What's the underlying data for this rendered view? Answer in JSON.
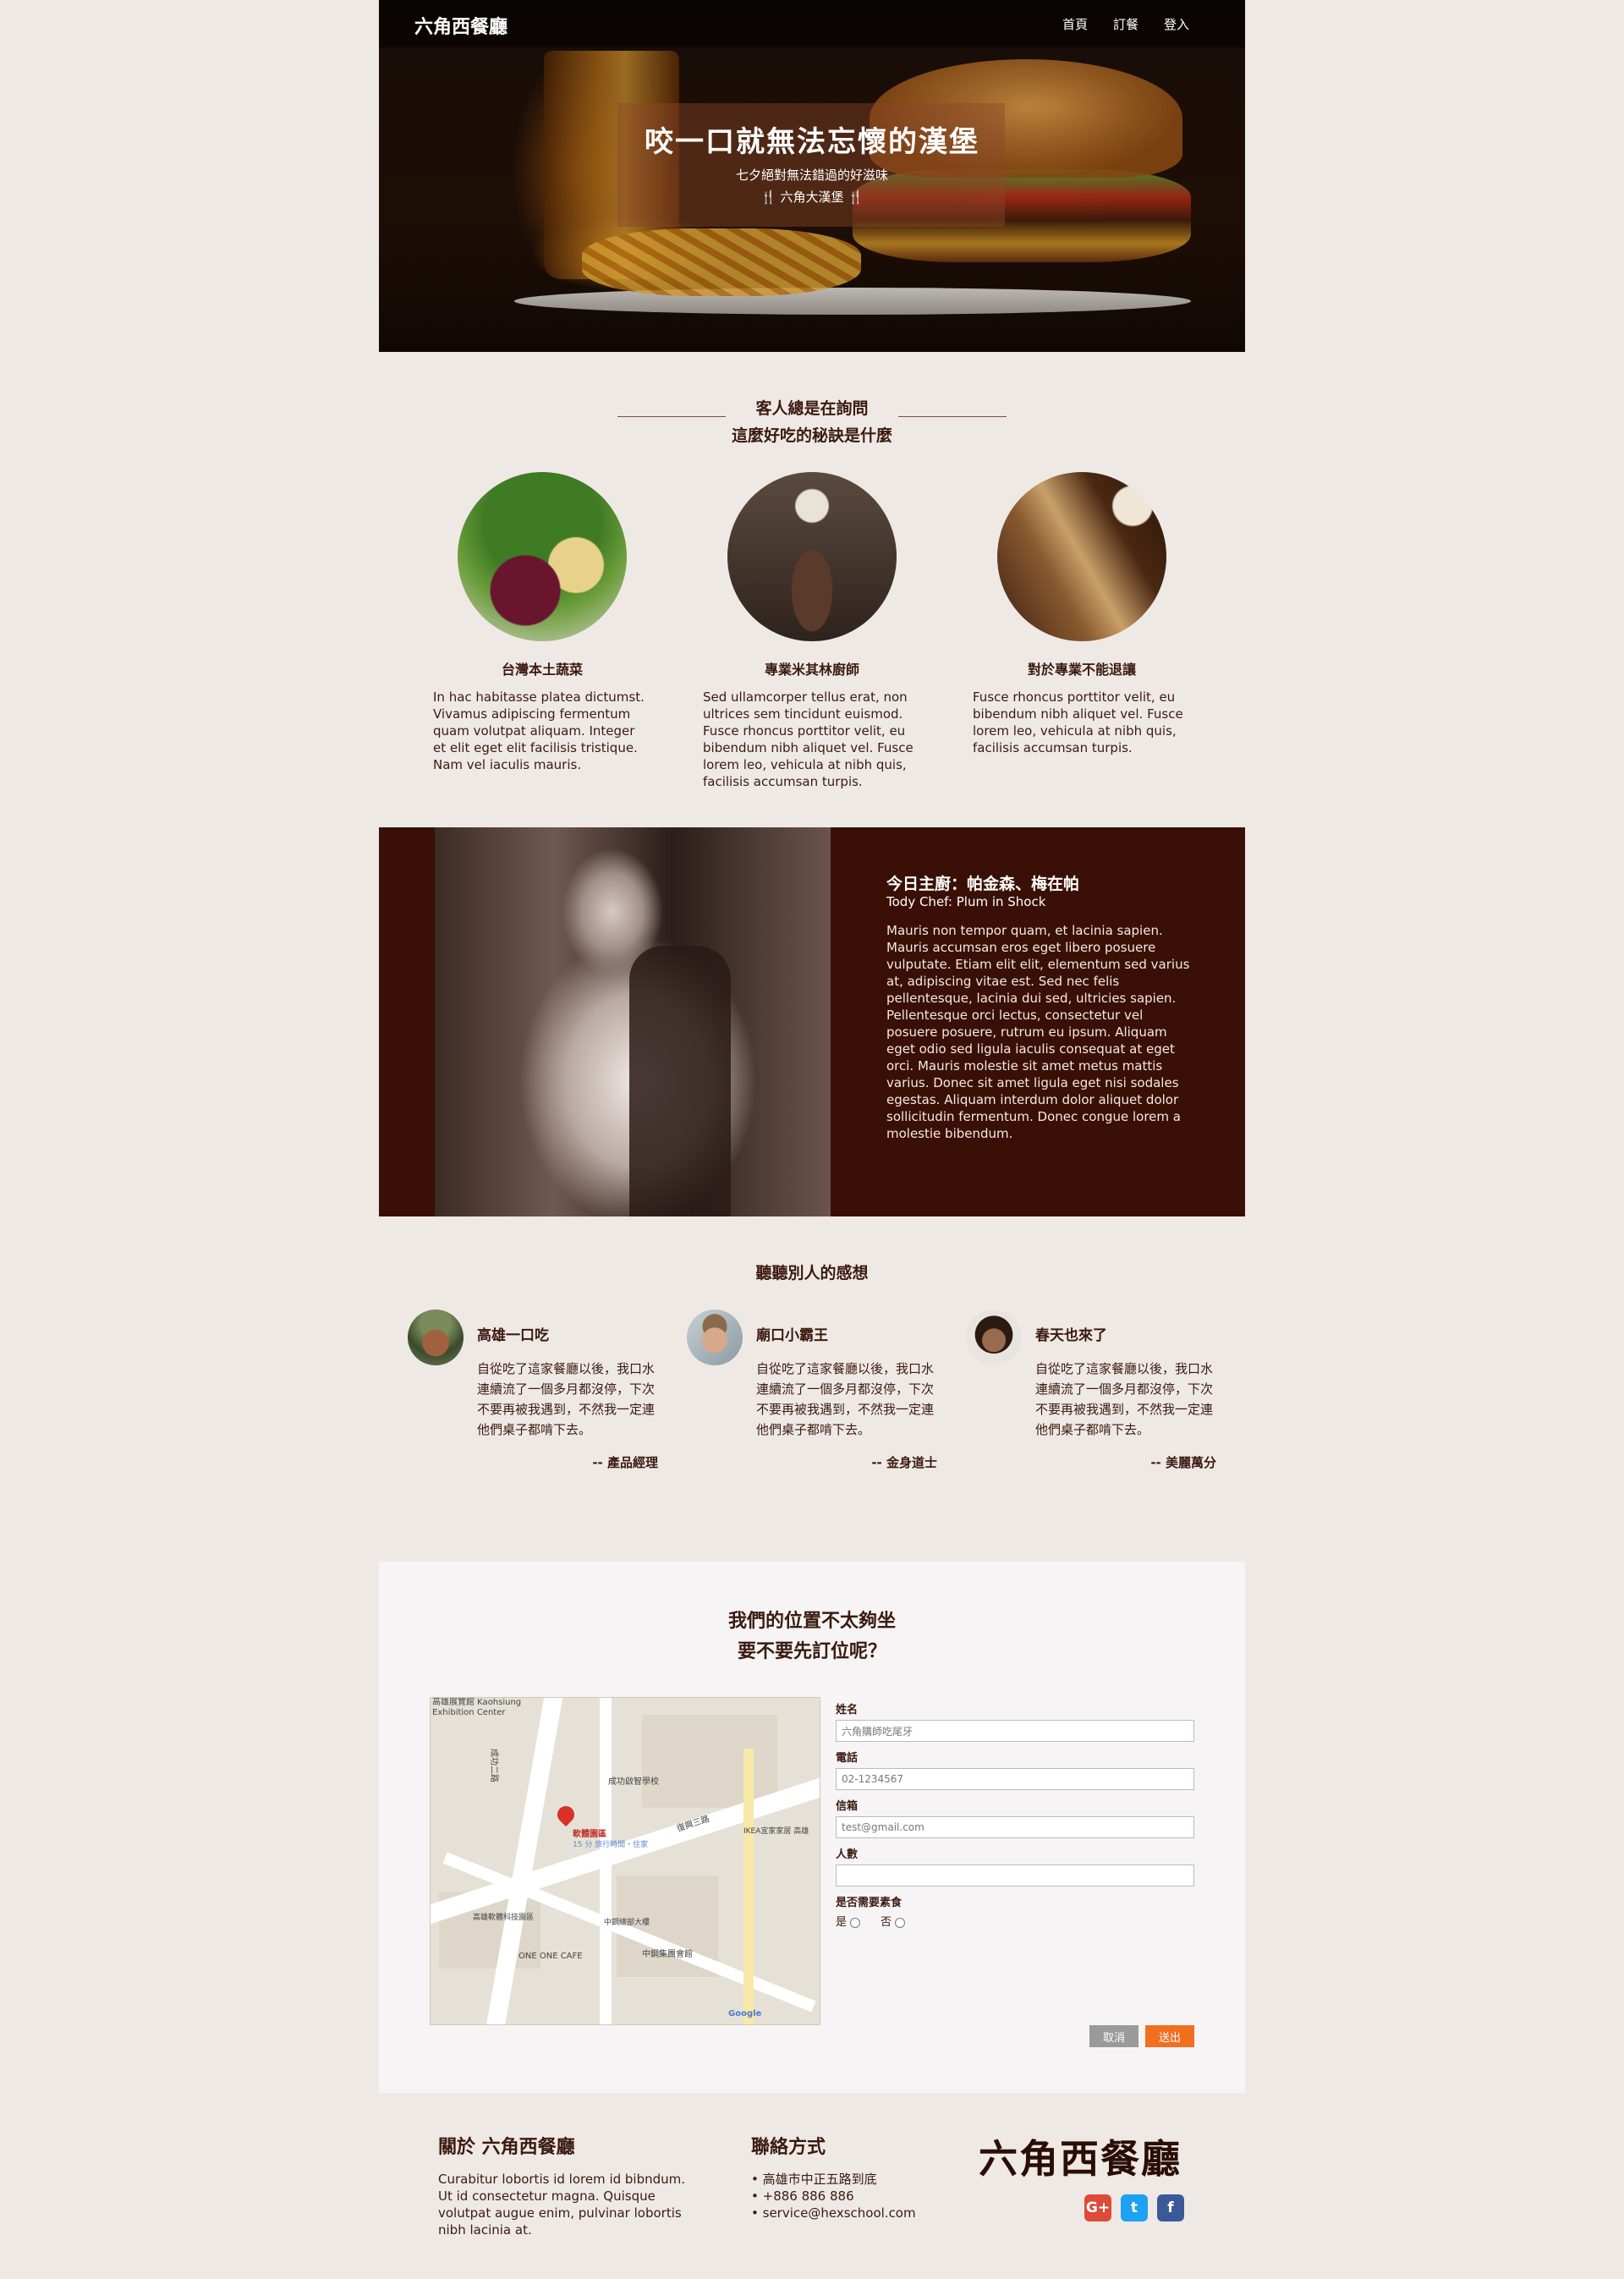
{
  "nav": {
    "brand": "六角西餐廳",
    "links": [
      "首頁",
      "訂餐",
      "登入"
    ]
  },
  "hero": {
    "title": "咬一口就無法忘懷的漢堡",
    "subtitle": "七夕絕對無法錯過的好滋味",
    "tagline": "🍴 六角大漢堡 🍴"
  },
  "secrets": {
    "heading1": "客人總是在詢問",
    "heading2": "這麼好吃的秘訣是什麼",
    "items": [
      {
        "title": "台灣本土蔬菜",
        "text": "In hac habitasse platea dictumst. Vivamus adipiscing fermentum quam volutpat aliquam. Integer et elit eget elit facilisis tristique. Nam vel iaculis mauris."
      },
      {
        "title": "專業米其林廚師",
        "text": "Sed ullamcorper tellus erat, non ultrices sem tincidunt euismod. Fusce rhoncus porttitor velit, eu bibendum nibh aliquet vel. Fusce lorem leo, vehicula at nibh quis, facilisis accumsan turpis."
      },
      {
        "title": "對於專業不能退讓",
        "text": "Fusce rhoncus porttitor velit, eu bibendum nibh aliquet vel. Fusce lorem leo, vehicula at nibh quis, facilisis accumsan turpis."
      }
    ]
  },
  "chef": {
    "title": "今日主廚：帕金森、梅在帕",
    "subtitle": "Tody Chef: Plum in Shock",
    "text": "Mauris non tempor quam, et lacinia sapien. Mauris accumsan eros eget libero posuere vulputate. Etiam elit elit, elementum sed varius at, adipiscing vitae est. Sed nec felis pellentesque, lacinia dui sed, ultricies sapien. Pellentesque orci lectus, consectetur vel posuere posuere, rutrum eu ipsum. Aliquam eget odio sed ligula iaculis consequat at eget orci. Mauris molestie sit amet metus mattis varius. Donec sit amet ligula eget nisi sodales egestas. Aliquam interdum dolor aliquet dolor sollicitudin fermentum. Donec congue lorem a molestie bibendum."
  },
  "testimonials": {
    "heading": "聽聽別人的感想",
    "items": [
      {
        "name": "高雄一口吃",
        "text": "自從吃了這家餐廳以後，我口水連續流了一個多月都沒停，下次不要再被我遇到，不然我一定連他們桌子都啃下去。",
        "role": "-- 產品經理"
      },
      {
        "name": "廟口小霸王",
        "text": "自從吃了這家餐廳以後，我口水連續流了一個多月都沒停，下次不要再被我遇到，不然我一定連他們桌子都啃下去。",
        "role": "-- 金身道士"
      },
      {
        "name": "春天也來了",
        "text": "自從吃了這家餐廳以後，我口水連續流了一個多月都沒停，下次不要再被我遇到，不然我一定連他們桌子都啃下去。",
        "role": "-- 美麗萬分"
      }
    ]
  },
  "reservation": {
    "title1": "我們的位置不太夠坐",
    "title2": "要不要先訂位呢？",
    "map_labels": {
      "exhibition": "高雄展覽館 Kaohsiung Exhibition Center",
      "road_a": "成功二路",
      "road_b": "復興三路",
      "software_park": "軟體園區",
      "software_park_sub": "15 分 旅行時間・住家",
      "ikea": "IKEA宜家家居 高雄",
      "one_one_cafe": "ONE ONE CAFE",
      "cafeteria": "中鋼集團會館",
      "tech_building": "高雄軟體科技園區",
      "shipbuilding": "中鋼總部大樓",
      "school": "成功啟智學校",
      "google": "Google"
    },
    "fields": [
      {
        "label": "姓名",
        "value": "六角購師吃尾牙"
      },
      {
        "label": "電話",
        "value": "02-1234567"
      },
      {
        "label": "信箱",
        "value": "test@gmail.com"
      },
      {
        "label": "人數",
        "value": ""
      }
    ],
    "vegetarian": {
      "label": "是否需要素食",
      "yes": "是",
      "no": "否"
    },
    "cancel": "取消",
    "submit": "送出"
  },
  "footer": {
    "about_title": "關於 六角西餐廳",
    "about_text": "Curabitur lobortis id lorem id bibndum. Ut id consectetur magna. Quisque volutpat augue enim, pulvinar lobortis nibh lacinia at.",
    "contact_title": "聯絡方式",
    "contacts": [
      "高雄市中正五路到底",
      "+886 886 886",
      "service@hexschool.com"
    ],
    "logo": "六角西餐廳",
    "social": {
      "gplus": "G+",
      "twitter": "t",
      "facebook": "f"
    }
  },
  "colors": {
    "brand_dark": "#3a0f05",
    "accent": "#f07020",
    "background": "#efe9e6"
  }
}
